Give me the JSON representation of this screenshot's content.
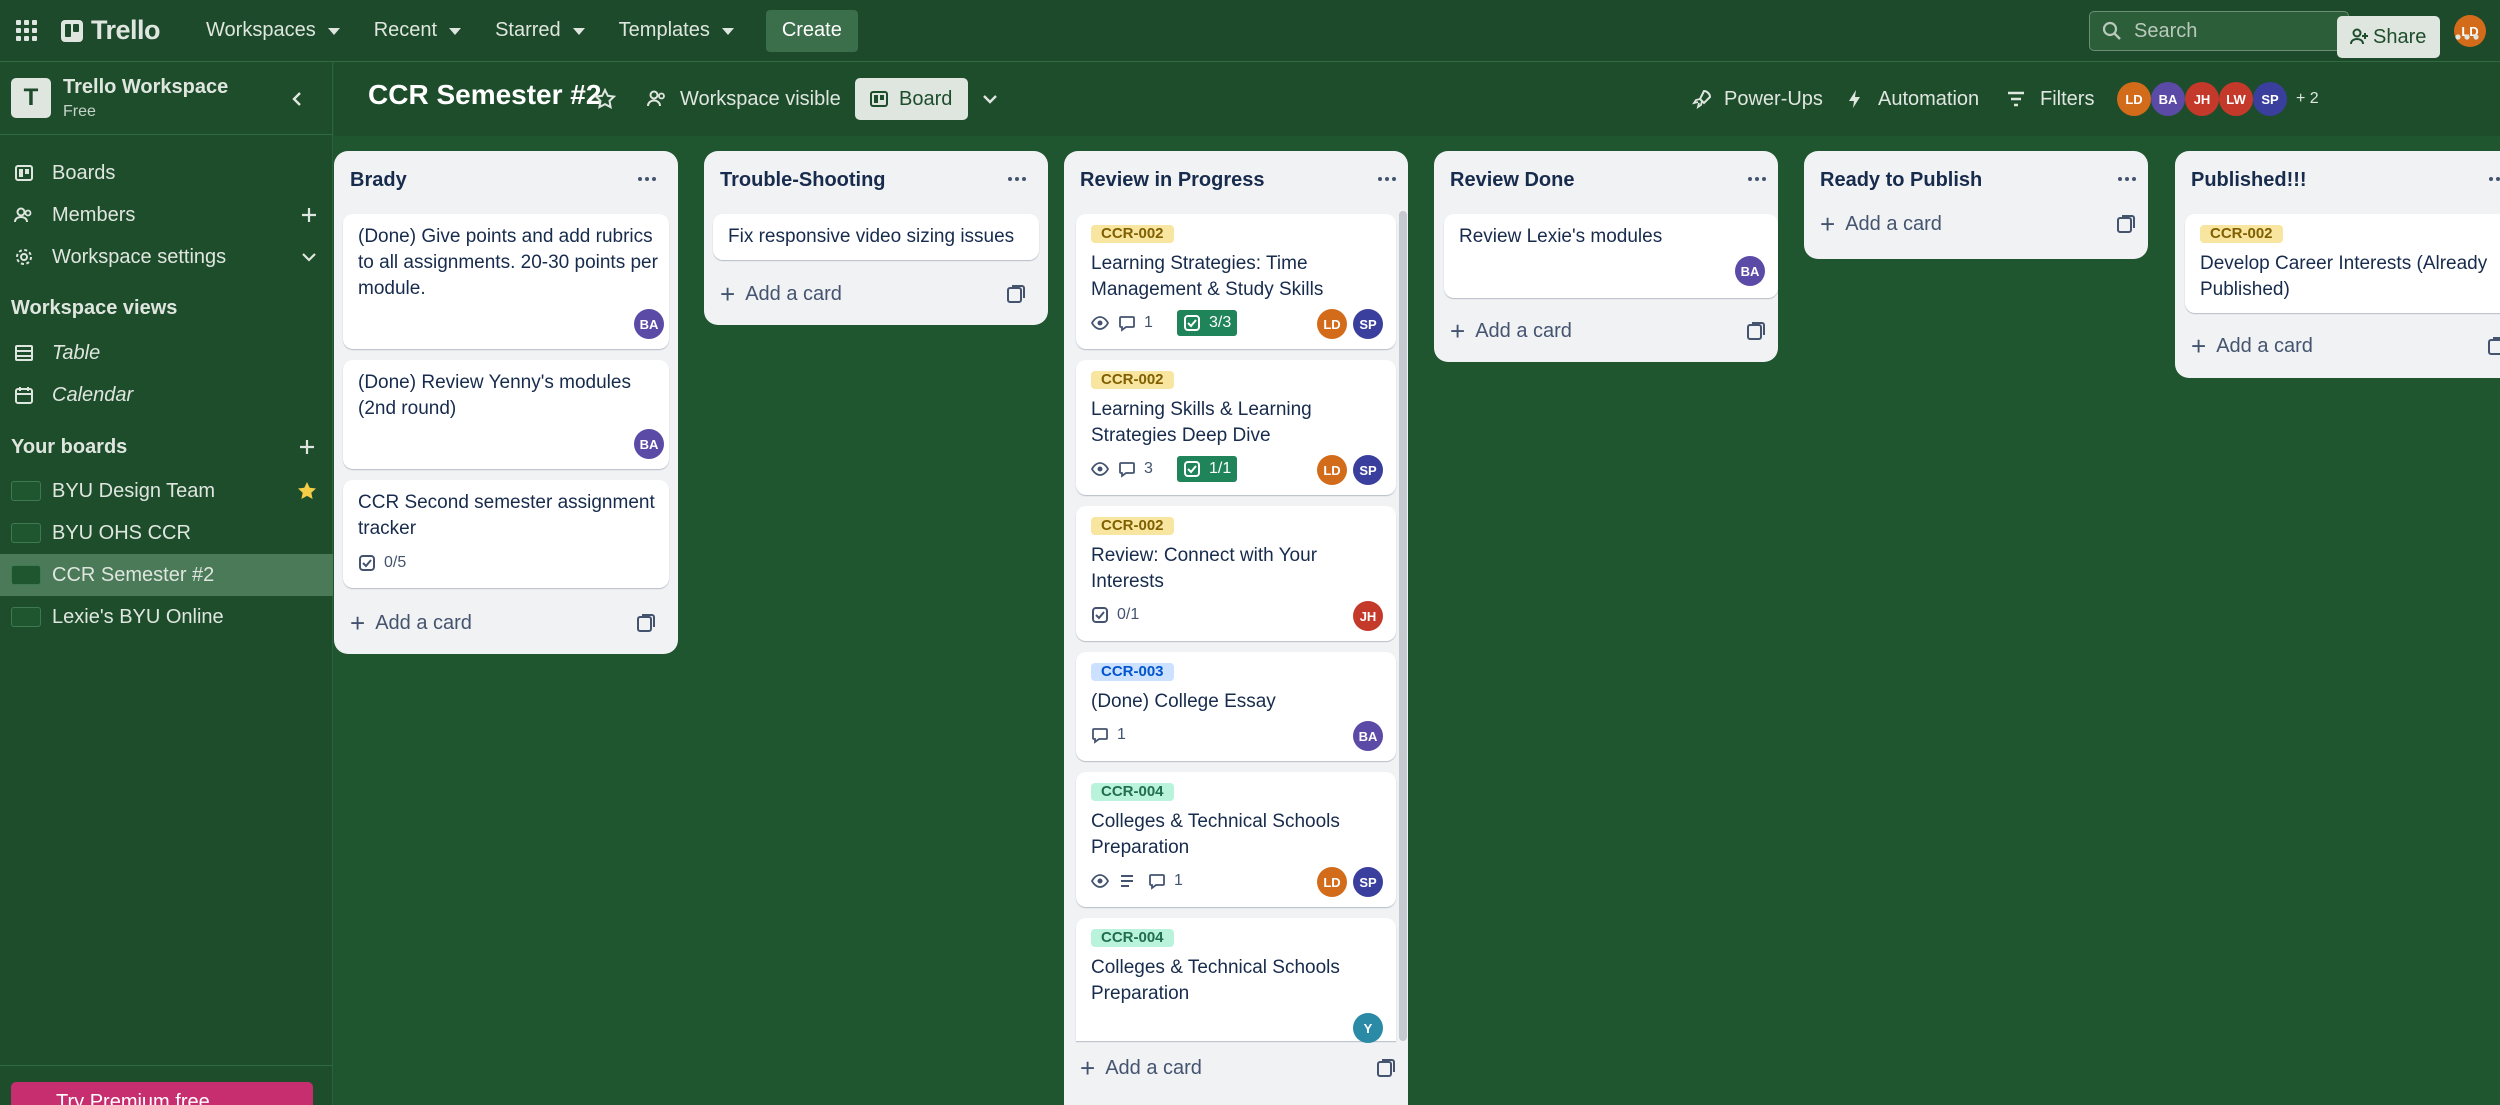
{
  "topbar": {
    "logo": "Trello",
    "nav": [
      "Workspaces",
      "Recent",
      "Starred",
      "Templates"
    ],
    "create": "Create",
    "search_placeholder": "Search",
    "user_initials": "LD"
  },
  "sidebar": {
    "workspace_initial": "T",
    "workspace_name": "Trello Workspace",
    "plan": "Free",
    "links": [
      "Boards",
      "Members",
      "Workspace settings"
    ],
    "views_heading": "Workspace views",
    "views": [
      "Table",
      "Calendar"
    ],
    "boards_heading": "Your boards",
    "boards": [
      {
        "name": "BYU Design Team",
        "starred": true
      },
      {
        "name": "BYU OHS CCR",
        "starred": false
      },
      {
        "name": "CCR Semester #2",
        "starred": false,
        "active": true
      },
      {
        "name": "Lexie's BYU Online",
        "starred": false
      }
    ],
    "premium": "Try Premium free"
  },
  "board": {
    "title": "CCR Semester #2",
    "visibility": "Workspace visible",
    "view": "Board",
    "power_ups": "Power-Ups",
    "automation": "Automation",
    "filters": "Filters",
    "members": [
      "LD",
      "BA",
      "JH",
      "LW",
      "SP"
    ],
    "extra_members": "+ 2",
    "share": "Share"
  },
  "common": {
    "add_card": "Add a card"
  },
  "lists": [
    {
      "title": "Brady",
      "cards": [
        {
          "title": "(Done) Give points and add rubrics to all assignments. 20-30 points per module.",
          "members": [
            "BA"
          ]
        },
        {
          "title": "(Done) Review Yenny's modules (2nd round)",
          "members": [
            "BA"
          ]
        },
        {
          "title": "CCR Second semester assignment tracker",
          "checklist": "0/5"
        }
      ]
    },
    {
      "title": "Trouble-Shooting",
      "cards": [
        {
          "title": "Fix responsive video sizing issues"
        }
      ]
    },
    {
      "title": "Review in Progress",
      "cards": [
        {
          "label": "CCR-002",
          "label_color": "yellow",
          "title": "Learning Strategies: Time Management & Study Skills",
          "comments": "1",
          "checklist": "3/3",
          "members": [
            "LD",
            "SP"
          ]
        },
        {
          "label": "CCR-002",
          "label_color": "yellow",
          "title": "Learning Skills & Learning Strategies Deep Dive",
          "comments": "3",
          "checklist": "1/1",
          "members": [
            "LD",
            "SP"
          ]
        },
        {
          "label": "CCR-002",
          "label_color": "yellow",
          "title": "Review: Connect with Your Interests",
          "checklist": "0/1",
          "members": [
            "JH"
          ]
        },
        {
          "label": "CCR-003",
          "label_color": "blue",
          "title": "(Done) College Essay",
          "comments": "1",
          "members": [
            "BA"
          ]
        },
        {
          "label": "CCR-004",
          "label_color": "green",
          "title": "Colleges & Technical Schools Preparation",
          "comments": "1",
          "members": [
            "LD",
            "SP"
          ]
        },
        {
          "label": "CCR-004",
          "label_color": "green",
          "title": "Colleges & Technical Schools Preparation",
          "members": [
            "Y"
          ]
        }
      ]
    },
    {
      "title": "Review Done",
      "cards": [
        {
          "title": "Review Lexie's modules",
          "members": [
            "BA"
          ]
        }
      ]
    },
    {
      "title": "Ready to Publish",
      "cards": []
    },
    {
      "title": "Published!!!",
      "cards": [
        {
          "label": "CCR-002",
          "label_color": "yellow",
          "title": "Develop Career Interests (Already Published)"
        }
      ]
    }
  ]
}
